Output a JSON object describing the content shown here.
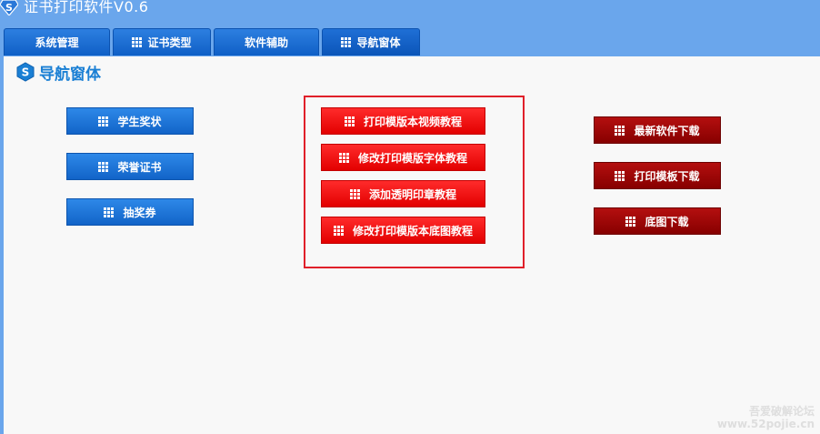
{
  "window": {
    "title": "证书打印软件V0.6"
  },
  "tabs": [
    {
      "label": "系统管理",
      "icon": "none"
    },
    {
      "label": "证书类型",
      "icon": "grid-icon"
    },
    {
      "label": "软件辅助",
      "icon": "none"
    },
    {
      "label": "导航窗体",
      "icon": "grid-icon",
      "active": true
    }
  ],
  "panel": {
    "title": "导航窗体"
  },
  "left_buttons": [
    {
      "label": "学生奖状"
    },
    {
      "label": "荣誉证书"
    },
    {
      "label": "抽奖券"
    }
  ],
  "middle_buttons": [
    {
      "label": "打印模版本视频教程"
    },
    {
      "label": "修改打印模版字体教程"
    },
    {
      "label": "添加透明印章教程"
    },
    {
      "label": "修改打印模版本底图教程"
    }
  ],
  "right_buttons": [
    {
      "label": "最新软件下载"
    },
    {
      "label": "打印模板下载"
    },
    {
      "label": "底图下载"
    }
  ],
  "watermark": {
    "line1": "吾爱破解论坛",
    "line2": "www.52pojie.cn"
  },
  "colors": {
    "title_bar": "#6aa6ec",
    "tab": "#1565c8",
    "panel_bg": "#f8f8f8",
    "blue_button": "#1a6fd0",
    "red_button": "#f00c0c",
    "dark_red_button": "#9e0606",
    "highlight_border": "#e0202a",
    "panel_title": "#1a7fd4"
  }
}
